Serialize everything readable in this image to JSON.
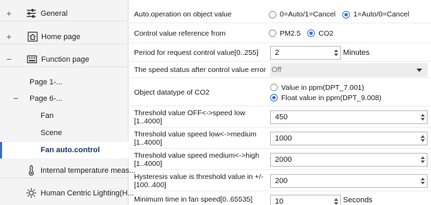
{
  "sidebar": {
    "general": {
      "toggle": "+",
      "label": "General",
      "icon": "sliders-icon"
    },
    "home": {
      "toggle": "+",
      "label": "Home page",
      "icon": "home-icon"
    },
    "function": {
      "toggle": "−",
      "label": "Function page",
      "icon": "keyboard-icon"
    },
    "page1": {
      "label": "Page 1-..."
    },
    "page6": {
      "toggle": "−",
      "label": "Page 6-..."
    },
    "fan": {
      "label": "Fan"
    },
    "scene": {
      "label": "Scene"
    },
    "fan_auto": {
      "label": "Fan auto.control"
    },
    "temp": {
      "label": "Internal temperature meas...",
      "icon": "thermometer-icon"
    },
    "hcl": {
      "label": "Human Centric Lighting(H...",
      "icon": "sun-icon"
    }
  },
  "params": {
    "auto_op": {
      "label": "Auto.operation on object value",
      "options": [
        "0=Auto/1=Cancel",
        "1=Auto/0=Cancel"
      ],
      "selected": "1=Auto/0=Cancel"
    },
    "ref": {
      "label": "Control value reference from",
      "options": [
        "PM2.5",
        "CO2"
      ],
      "selected": "CO2"
    },
    "period": {
      "label": "Period for request control value[0..255]",
      "value": "2",
      "unit": "Minutes"
    },
    "speed_status": {
      "label": "The speed status after control value error",
      "value": "Off"
    },
    "datatype": {
      "label": "Object datatype of CO2",
      "options": [
        "Value in ppm(DPT_7.001)",
        "Float value in ppm(DPT_9.008)"
      ],
      "selected": "Float value in ppm(DPT_9.008)"
    },
    "th_off_low": {
      "label": "Threshold value OFF<->speed low [1..4000]",
      "value": "450"
    },
    "th_low_med": {
      "label": "Threshold value speed low<->medium [1..4000]",
      "value": "1000"
    },
    "th_med_high": {
      "label": "Threshold value speed medium<->high [1..4000]",
      "value": "2000"
    },
    "hysteresis": {
      "label": "Hysteresis value is threshold value in +/- [100..400]",
      "value": "200"
    },
    "min_time": {
      "label": "Minimum time in fan speed[0..65535]",
      "value": "10",
      "unit": "Seconds"
    }
  },
  "colors": {
    "accent": "#2f6fd6",
    "sidebar_bg": "#f4f4f4",
    "active_item_bg": "#ffffff"
  }
}
